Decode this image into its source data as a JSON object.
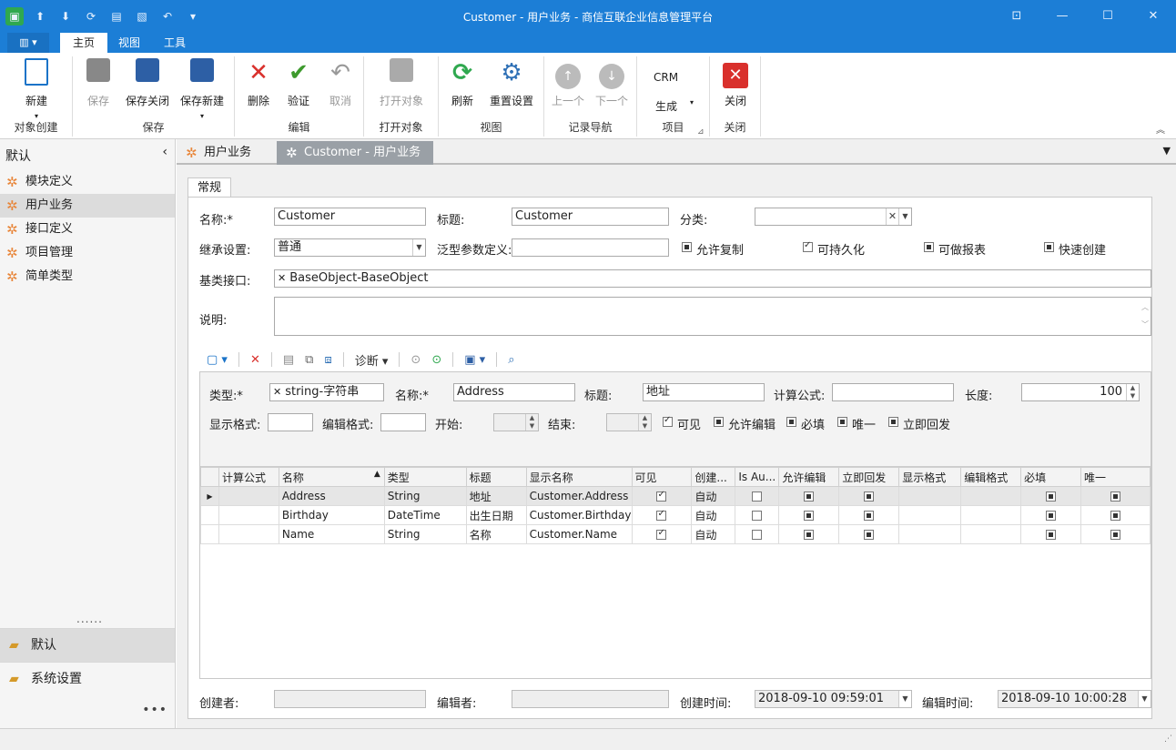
{
  "window": {
    "title": "Customer - 用户业务 - 商信互联企业信息管理平台"
  },
  "ribbon_tabs": [
    "主页",
    "视图",
    "工具"
  ],
  "ribbon": {
    "groups": [
      {
        "label": "对象创建",
        "buttons": [
          {
            "label": "新建",
            "icon": "new-page-icon"
          }
        ]
      },
      {
        "label": "保存",
        "buttons": [
          {
            "label": "保存",
            "icon": "save-icon"
          },
          {
            "label": "保存关闭",
            "icon": "save-close-icon"
          },
          {
            "label": "保存新建",
            "icon": "save-new-icon"
          }
        ]
      },
      {
        "label": "编辑",
        "buttons": [
          {
            "label": "删除",
            "icon": "delete-icon"
          },
          {
            "label": "验证",
            "icon": "check-icon"
          },
          {
            "label": "取消",
            "icon": "undo-icon"
          }
        ]
      },
      {
        "label": "打开对象",
        "buttons": [
          {
            "label": "打开对象",
            "icon": "open-object-icon"
          }
        ]
      },
      {
        "label": "视图",
        "buttons": [
          {
            "label": "刷新",
            "icon": "refresh-icon"
          },
          {
            "label": "重置设置",
            "icon": "reset-settings-icon"
          }
        ]
      },
      {
        "label": "记录导航",
        "buttons": [
          {
            "label": "上一个",
            "icon": "arrow-up-icon"
          },
          {
            "label": "下一个",
            "icon": "arrow-down-icon"
          }
        ]
      },
      {
        "label": "项目",
        "buttons": [
          {
            "label": "CRM"
          },
          {
            "label": "生成"
          }
        ]
      },
      {
        "label": "关闭",
        "buttons": [
          {
            "label": "关闭",
            "icon": "close-icon"
          }
        ]
      }
    ]
  },
  "sidebar": {
    "header": "默认",
    "items": [
      "模块定义",
      "用户业务",
      "接口定义",
      "项目管理",
      "简单类型"
    ],
    "dots": "......",
    "groups": [
      "默认",
      "系统设置"
    ],
    "more": "•••"
  },
  "doc_tabs": [
    "用户业务",
    "Customer - 用户业务"
  ],
  "form": {
    "tab": "常规",
    "name_label": "名称:*",
    "name_value": "Customer",
    "title_label": "标题:",
    "title_value": "Customer",
    "category_label": "分类:",
    "category_value": "",
    "inherit_label": "继承设置:",
    "inherit_value": "普通",
    "generic_label": "泛型参数定义:",
    "generic_value": "",
    "checkboxes": [
      "允许复制",
      "可持久化",
      "可做报表",
      "快速创建"
    ],
    "base_label": "基类接口:",
    "base_value": "BaseObject-BaseObject",
    "desc_label": "说明:",
    "toolbar_diag": "诊断"
  },
  "subform": {
    "type_label": "类型:*",
    "type_value": "string-字符串",
    "name_label": "名称:*",
    "name_value": "Address",
    "title_label": "标题:",
    "title_value": "地址",
    "formula_label": "计算公式:",
    "formula_value": "",
    "length_label": "长度:",
    "length_value": "100",
    "display_fmt_label": "显示格式:",
    "edit_fmt_label": "编辑格式:",
    "start_label": "开始:",
    "end_label": "结束:",
    "checkboxes": [
      "可见",
      "允许编辑",
      "必填",
      "唯一",
      "立即回发"
    ]
  },
  "grid": {
    "columns": [
      "计算公式",
      "名称",
      "类型",
      "标题",
      "显示名称",
      "可见",
      "创建...",
      "Is Au...",
      "允许编辑",
      "立即回发",
      "显示格式",
      "编辑格式",
      "必填",
      "唯一"
    ],
    "rows": [
      {
        "name": "Address",
        "type": "String",
        "title": "地址",
        "display": "Customer.Address",
        "created": "自动"
      },
      {
        "name": "Birthday",
        "type": "DateTime",
        "title": "出生日期",
        "display": "Customer.Birthday",
        "created": "自动"
      },
      {
        "name": "Name",
        "type": "String",
        "title": "名称",
        "display": "Customer.Name",
        "created": "自动"
      }
    ]
  },
  "bottom": {
    "creator_label": "创建者:",
    "editor_label": "编辑者:",
    "created_time_label": "创建时间:",
    "created_time_value": "2018-09-10 09:59:01",
    "edited_time_label": "编辑时间:",
    "edited_time_value": "2018-09-10 10:00:28"
  }
}
